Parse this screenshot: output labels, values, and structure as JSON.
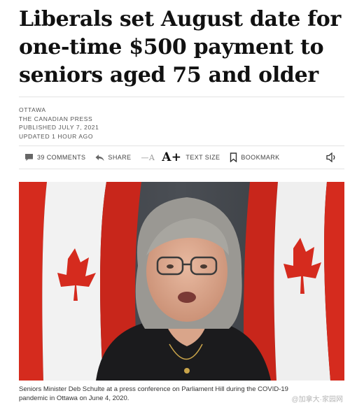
{
  "article": {
    "headline_line1": "Liberals set August date for",
    "headline_line2": "one-time $500 payment to",
    "headline_line3": "seniors aged 75 and older"
  },
  "meta": {
    "location": "OTTAWA",
    "source": "THE CANADIAN PRESS",
    "published": "PUBLISHED JULY 7, 2021",
    "updated": "UPDATED 1 HOUR AGO"
  },
  "toolbar": {
    "comments_label": "39 COMMENTS",
    "share_label": "SHARE",
    "font_minus_label": "—A",
    "font_plus_label": "A+",
    "text_size_label": "TEXT SIZE",
    "bookmark_label": "BOOKMARK"
  },
  "photo": {
    "caption_line1": "Seniors Minister Deb Schulte at a press conference on Parliament Hill during the COVID-19",
    "caption_line2": "pandemic in Ottawa on June 4, 2020."
  },
  "watermark": {
    "text": "@加拿大·家园网"
  },
  "colors": {
    "flag_red": "#d52b1e",
    "background": "#ffffff",
    "text": "#111111"
  },
  "icons": [
    "comment-icon",
    "share-icon",
    "bookmark-icon",
    "speaker-icon"
  ]
}
